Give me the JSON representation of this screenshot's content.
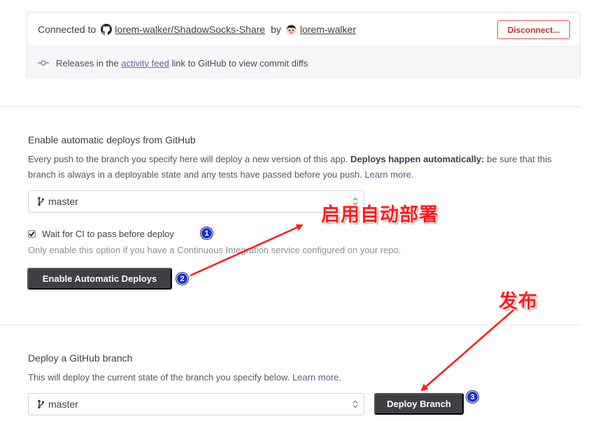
{
  "connection": {
    "connected_to": "Connected to",
    "repo": "lorem-walker/ShadowSocks-Share",
    "by": "by",
    "user": "lorem-walker",
    "disconnect_label": "Disconnect...",
    "releases_prefix": "Releases in the",
    "activity_feed": "activity feed",
    "releases_suffix": "link to GitHub to view commit diffs"
  },
  "auto_deploy": {
    "heading": "Enable automatic deploys from GitHub",
    "desc_plain": "Every push to the branch you specify here will deploy a new version of this app.",
    "desc_bold": "Deploys happen automatically:",
    "desc_rest": "be sure that this branch is always in a deployable state and any tests have passed before you push.",
    "learn_more": "Learn more.",
    "branch": "master",
    "ci_label": "Wait for CI to pass before deploy",
    "ci_checked": true,
    "ci_hint": "Only enable this option if you have a Continuous Integration service configured on your repo.",
    "enable_button": "Enable Automatic Deploys"
  },
  "manual_deploy": {
    "heading": "Deploy a GitHub branch",
    "desc": "This will deploy the current state of the branch you specify below.",
    "learn_more": "Learn more.",
    "branch": "master",
    "deploy_button": "Deploy Branch"
  },
  "annotations": {
    "enable_note": "启用自动部署",
    "publish_note": "发布",
    "badge_1": "1",
    "badge_2": "2",
    "badge_3": "3",
    "color": "#ff1a1a",
    "badge_color": "#1a2fd0"
  },
  "icons": [
    "github-icon",
    "avatar",
    "commit-icon",
    "branch-icon",
    "select-caret-icon",
    "checkmark-icon"
  ]
}
